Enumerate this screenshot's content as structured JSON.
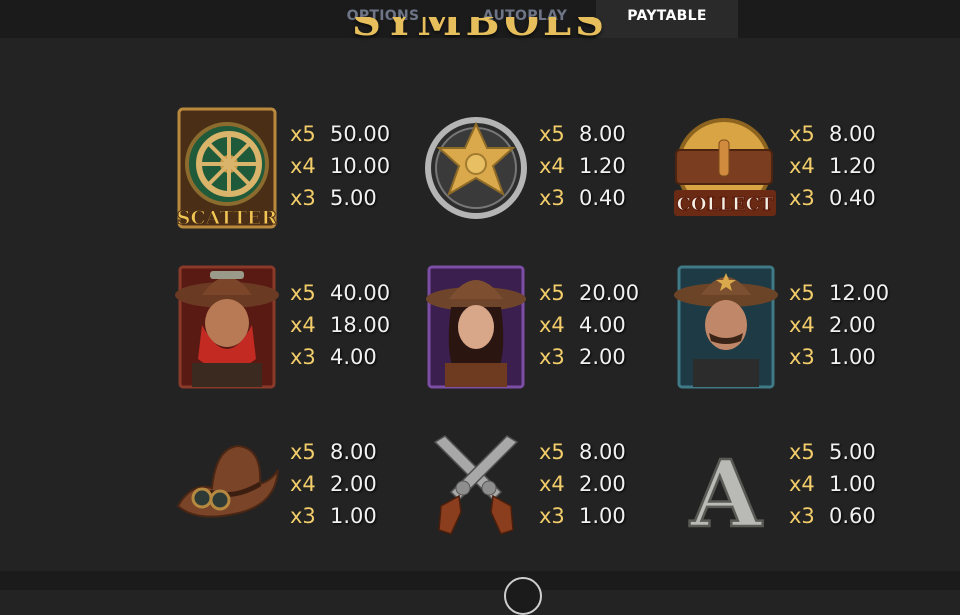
{
  "tabs": [
    {
      "label": "OPTIONS"
    },
    {
      "label": "AUTOPLAY"
    },
    {
      "label": "PAYTABLE"
    }
  ],
  "active_tab": "PAYTABLE",
  "section_heading": "SYMBOLS",
  "accent_color": "#f2cd6a",
  "symbols": [
    {
      "icon": "scatter-wheel-icon",
      "label": "SCATTER",
      "pays": [
        {
          "mult": "x5",
          "amount": "50.00"
        },
        {
          "mult": "x4",
          "amount": "10.00"
        },
        {
          "mult": "x3",
          "amount": "5.00"
        }
      ]
    },
    {
      "icon": "sheriff-badge-icon",
      "pays": [
        {
          "mult": "x5",
          "amount": "8.00"
        },
        {
          "mult": "x4",
          "amount": "1.20"
        },
        {
          "mult": "x3",
          "amount": "0.40"
        }
      ]
    },
    {
      "icon": "collect-belt-icon",
      "label": "COLLECT",
      "pays": [
        {
          "mult": "x5",
          "amount": "8.00"
        },
        {
          "mult": "x4",
          "amount": "1.20"
        },
        {
          "mult": "x3",
          "amount": "0.40"
        }
      ]
    },
    {
      "icon": "bandit-icon",
      "pays": [
        {
          "mult": "x5",
          "amount": "40.00"
        },
        {
          "mult": "x4",
          "amount": "18.00"
        },
        {
          "mult": "x3",
          "amount": "4.00"
        }
      ]
    },
    {
      "icon": "cowgirl-icon",
      "pays": [
        {
          "mult": "x5",
          "amount": "20.00"
        },
        {
          "mult": "x4",
          "amount": "4.00"
        },
        {
          "mult": "x3",
          "amount": "2.00"
        }
      ]
    },
    {
      "icon": "sheriff-icon",
      "pays": [
        {
          "mult": "x5",
          "amount": "12.00"
        },
        {
          "mult": "x4",
          "amount": "2.00"
        },
        {
          "mult": "x3",
          "amount": "1.00"
        }
      ]
    },
    {
      "icon": "cowboy-hat-icon",
      "pays": [
        {
          "mult": "x5",
          "amount": "8.00"
        },
        {
          "mult": "x4",
          "amount": "2.00"
        },
        {
          "mult": "x3",
          "amount": "1.00"
        }
      ]
    },
    {
      "icon": "crossed-revolvers-icon",
      "pays": [
        {
          "mult": "x5",
          "amount": "8.00"
        },
        {
          "mult": "x4",
          "amount": "2.00"
        },
        {
          "mult": "x3",
          "amount": "1.00"
        }
      ]
    },
    {
      "icon": "letter-a-icon",
      "label": "A",
      "pays": [
        {
          "mult": "x5",
          "amount": "5.00"
        },
        {
          "mult": "x4",
          "amount": "1.00"
        },
        {
          "mult": "x3",
          "amount": "0.60"
        }
      ]
    }
  ],
  "bottom_button_icon": "close-icon"
}
